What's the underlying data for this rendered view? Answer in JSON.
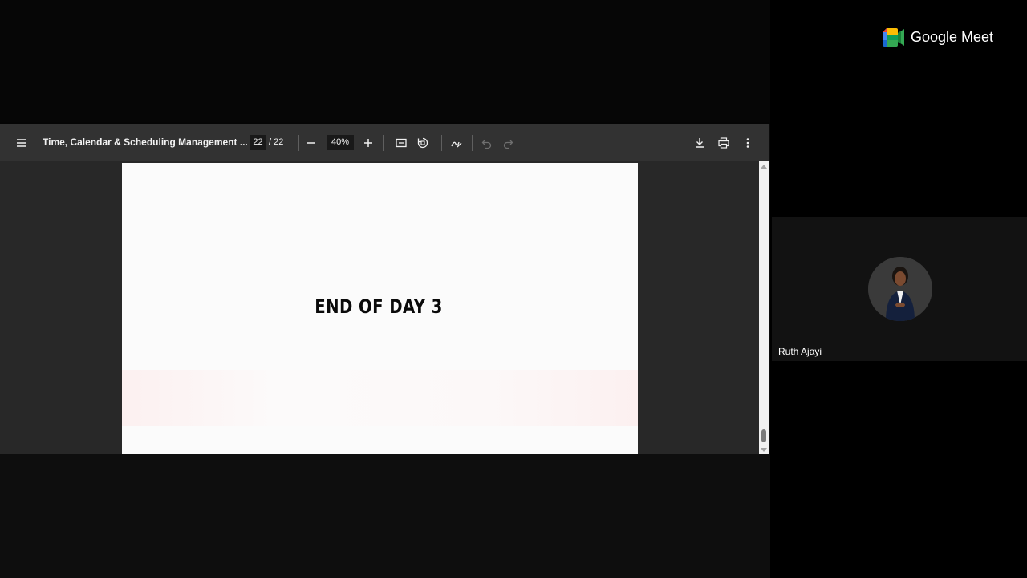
{
  "pdf_toolbar": {
    "title": "Time, Calendar & Scheduling Management ...",
    "page_current": "22",
    "page_total": "/ 22",
    "zoom": "40%",
    "icons": [
      "menu-icon",
      "zoom-out-icon",
      "zoom-in-icon",
      "fit-page-icon",
      "rotate-icon",
      "annotate-icon",
      "undo-icon",
      "redo-icon",
      "download-icon",
      "print-icon",
      "more-icon"
    ]
  },
  "pdf_page": {
    "heading": "END OF DAY 3"
  },
  "meet": {
    "brand": "Google Meet",
    "participant_name": "Ruth Ajayi"
  },
  "colors": {
    "toolbar_bg": "#323232",
    "viewer_bg": "#282828",
    "page_bg": "#fbfbfb"
  }
}
